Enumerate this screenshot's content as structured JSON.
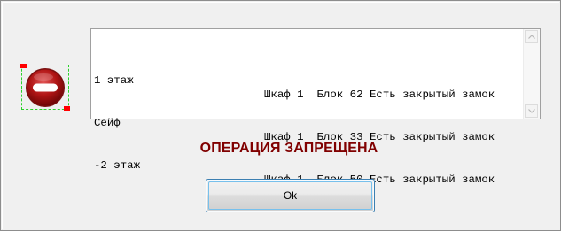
{
  "message_list": {
    "rows": [
      {
        "location": "1 этаж",
        "details": "Шкаф 1  Блок 62 Есть закрытый замок"
      },
      {
        "location": "Сейф",
        "details": "Шкаф 1  Блок 33 Есть закрытый замок"
      },
      {
        "location": "-2 этаж",
        "details": "Шкаф 1  Блок 50 Есть закрытый замок"
      }
    ],
    "scroll_up_icon": "chevron-up-icon",
    "scroll_down_icon": "chevron-down-icon"
  },
  "status_icon": "stop-icon",
  "heading": "ОПЕРАЦИЯ ЗАПРЕЩЕНА",
  "ok_button": {
    "label": "Ok"
  },
  "colors": {
    "heading": "#800000",
    "stop_icon": "#b01515",
    "selection_border": "#2ad12a",
    "selection_handle": "#ff0000",
    "button_focus": "#3c7fb1"
  }
}
